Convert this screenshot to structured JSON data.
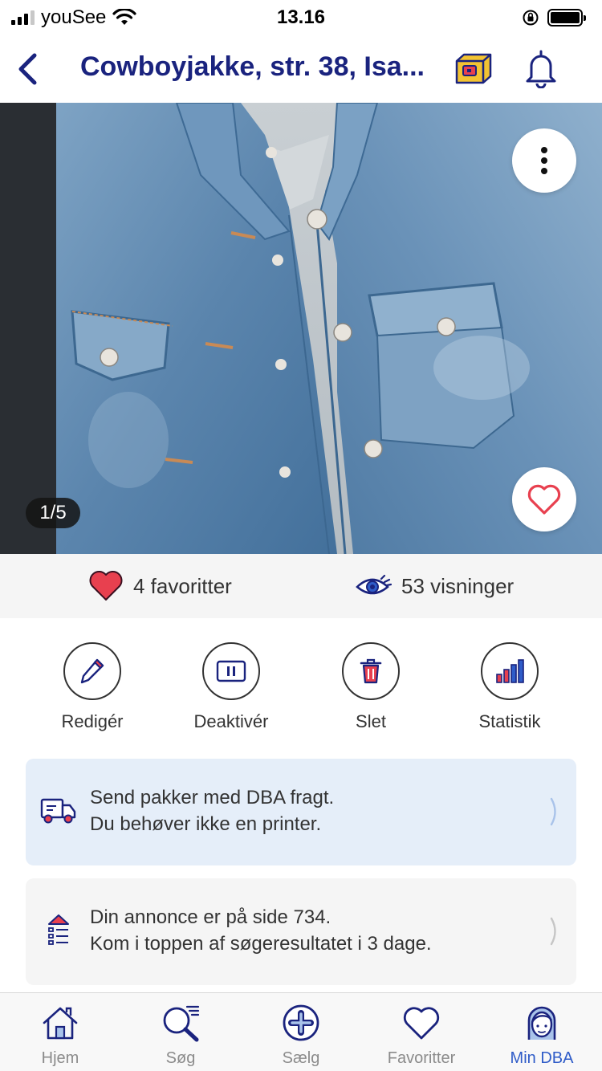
{
  "status_bar": {
    "carrier": "youSee",
    "time": "13.16"
  },
  "nav": {
    "title": "Cowboyjakke, str. 38, Isa..."
  },
  "photo": {
    "counter": "1/5"
  },
  "stats": {
    "favorites": "4 favoritter",
    "views": "53 visninger"
  },
  "actions": [
    {
      "label": "Redigér",
      "icon": "pencil-icon"
    },
    {
      "label": "Deaktivér",
      "icon": "pause-icon"
    },
    {
      "label": "Slet",
      "icon": "trash-icon"
    },
    {
      "label": "Statistik",
      "icon": "bar-chart-icon"
    }
  ],
  "cards": {
    "shipping": {
      "line1": "Send pakker med DBA fragt.",
      "line2": "Du behøver ikke en printer.",
      "icon": "truck-icon"
    },
    "ranking": {
      "line1": "Din annonce er på side 734.",
      "line2": "Kom i toppen af søgeresultatet i 3 dage.",
      "icon": "boost-list-icon"
    }
  },
  "tabs": [
    {
      "label": "Hjem",
      "icon": "home-icon"
    },
    {
      "label": "Søg",
      "icon": "search-icon"
    },
    {
      "label": "Sælg",
      "icon": "plus-circle-icon"
    },
    {
      "label": "Favoritter",
      "icon": "heart-icon"
    },
    {
      "label": "Min DBA",
      "icon": "profile-icon",
      "active": true
    }
  ],
  "colors": {
    "brand_navy": "#1a237e",
    "active_tab": "#2f5cc8",
    "heart_red": "#e8404f",
    "card_blue": "#e5eef9"
  }
}
